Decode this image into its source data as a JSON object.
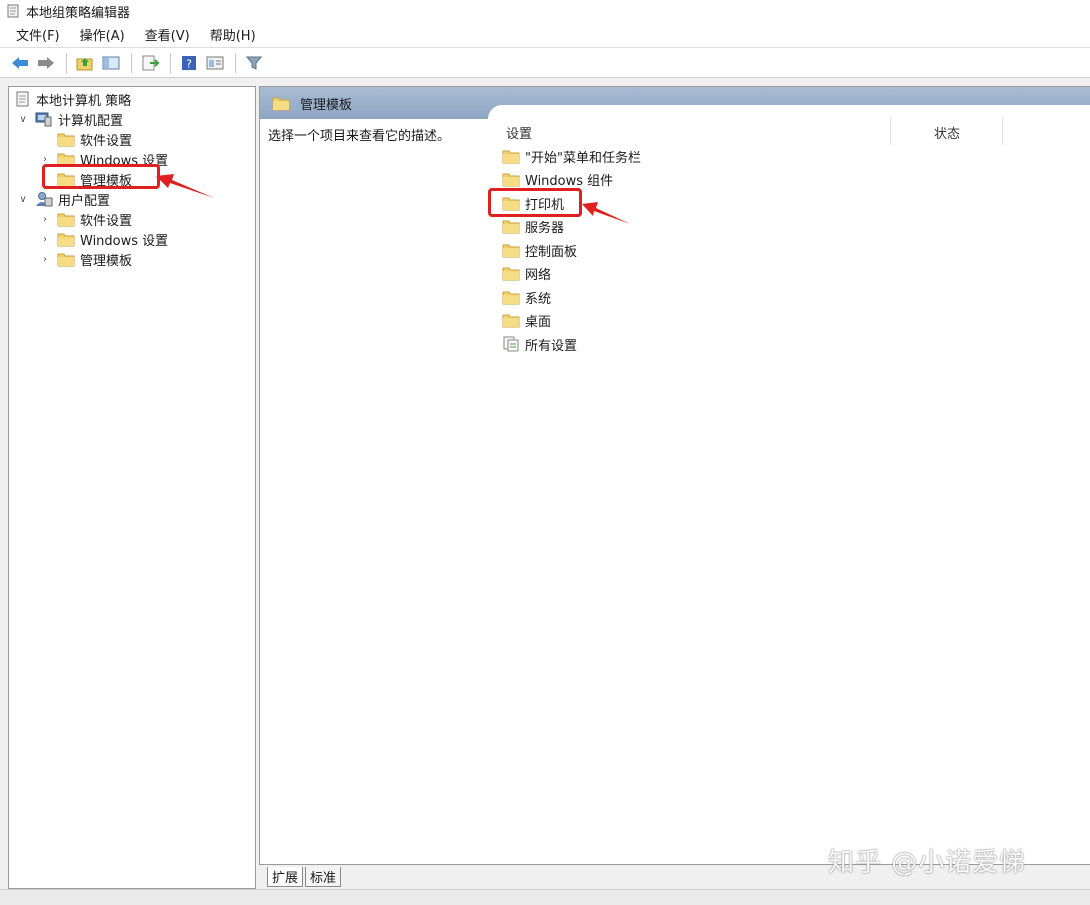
{
  "window": {
    "title": "本地组策略编辑器"
  },
  "menu": [
    {
      "label": "文件(F)"
    },
    {
      "label": "操作(A)"
    },
    {
      "label": "查看(V)"
    },
    {
      "label": "帮助(H)"
    }
  ],
  "tree": {
    "root": "本地计算机 策略",
    "computer_config": "计算机配置",
    "cc_software": "软件设置",
    "cc_windows": "Windows 设置",
    "cc_admin": "管理模板",
    "user_config": "用户配置",
    "uc_software": "软件设置",
    "uc_windows": "Windows 设置",
    "uc_admin": "管理模板"
  },
  "right": {
    "header": "管理模板",
    "description": "选择一个项目来查看它的描述。",
    "col_setting": "设置",
    "col_status": "状态",
    "items": [
      "\"开始\"菜单和任务栏",
      "Windows 组件",
      "打印机",
      "服务器",
      "控制面板",
      "网络",
      "系统",
      "桌面",
      "所有设置"
    ]
  },
  "tabs": {
    "extended": "扩展",
    "standard": "标准"
  },
  "watermark": "知乎 @小诺爱悌",
  "colors": {
    "highlight": "#e02020",
    "folder": "#f2cf6b",
    "header": "#98afca"
  }
}
